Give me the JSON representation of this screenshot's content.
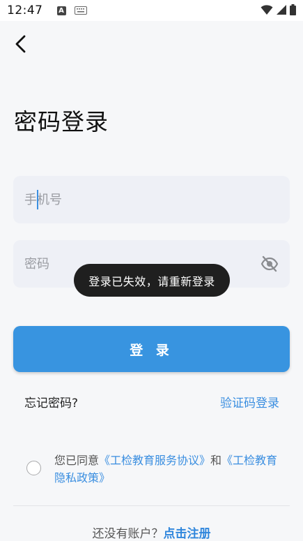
{
  "status_bar": {
    "time": "12:47",
    "indicator_letter": "A"
  },
  "page": {
    "title": "密码登录"
  },
  "form": {
    "phone_placeholder": "手机号",
    "password_placeholder": "密码"
  },
  "toast": {
    "message": "登录已失效，请重新登录"
  },
  "actions": {
    "login_label": "登 录",
    "forgot_label": "忘记密码?",
    "sms_login_label": "验证码登录"
  },
  "agreement": {
    "prefix": "您已同意",
    "service_link": "《工检教育服务协议》",
    "conjunction": "和",
    "privacy_link": "《工检教育隐私政策》",
    "checked": false
  },
  "footer": {
    "prompt": "还没有账户？",
    "register_link": "点击注册"
  },
  "colors": {
    "accent": "#3894e0",
    "link": "#3a8ee0",
    "field_bg": "#eef0f6",
    "toast_bg": "#1f1f1f"
  },
  "icons": [
    "back-arrow-icon",
    "wifi-icon",
    "signal-icon",
    "battery-icon",
    "eye-off-icon",
    "keyboard-icon"
  ]
}
